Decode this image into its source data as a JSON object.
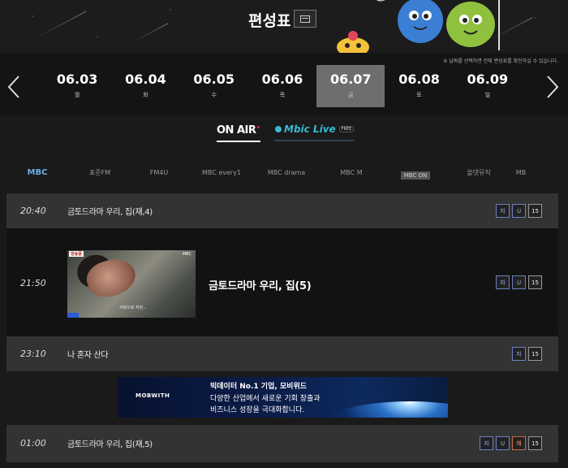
{
  "header": {
    "title": "편성표",
    "tv_button_icon": "tv-icon"
  },
  "datebar": {
    "notice": "※ 날짜를 선택하면 전체 편성표를 확인하실 수 있습니다.",
    "dates": [
      {
        "date": "06.03",
        "weekday": "월",
        "active": false
      },
      {
        "date": "06.04",
        "weekday": "화",
        "active": false
      },
      {
        "date": "06.05",
        "weekday": "수",
        "active": false
      },
      {
        "date": "06.06",
        "weekday": "목",
        "active": false
      },
      {
        "date": "06.07",
        "weekday": "금",
        "active": true
      },
      {
        "date": "06.08",
        "weekday": "토",
        "active": false
      },
      {
        "date": "06.09",
        "weekday": "일",
        "active": false
      }
    ]
  },
  "modes": {
    "onair": "ON AIR",
    "onair_dot": "•",
    "mbic": "Mbic Live",
    "mbic_badge": "FREE"
  },
  "channels": [
    {
      "label": "MBC",
      "active": true
    },
    {
      "label": "표준FM",
      "active": false
    },
    {
      "label": "FM4U",
      "active": false
    },
    {
      "label": "MBC every1",
      "active": false
    },
    {
      "label": "MBC drama",
      "active": false
    },
    {
      "label": "MBC M",
      "active": false
    },
    {
      "label": "MBC ON",
      "active": false
    },
    {
      "label": "올댓뮤직",
      "active": false
    },
    {
      "label": "MB",
      "active": false
    }
  ],
  "schedule": [
    {
      "time": "20:40",
      "title": "금토드라마 우리, 집(재,4)",
      "badges": [
        "자",
        "U",
        "15"
      ]
    },
    {
      "time": "21:50",
      "title": "금토드라마 우리, 집(5)",
      "badges": [
        "자",
        "U",
        "15"
      ]
    },
    {
      "time": "23:10",
      "title": "나 혼자 산다",
      "badges": [
        "자",
        "15"
      ]
    },
    {
      "time": "01:00",
      "title": "금토드라마 우리, 집(재,5)",
      "badges": [
        "자",
        "U",
        "해",
        "15"
      ]
    }
  ],
  "thumb": {
    "tag": "방송중",
    "channel": "MBC",
    "subtitle": "사랑으로 자란..."
  },
  "ad": {
    "brand": "MOBWITH",
    "line1": "빅데이터 No.1 기업, 모비위드",
    "line2": "다양한 산업에서 새로운 기회 창출과",
    "line3": "비즈니스 성장을 극대화합니다."
  },
  "colors": {
    "active_date_bg": "#6e6e6e",
    "row_bg": "#333333",
    "accent_blue": "#6fb0e8",
    "onair_dot": "#e0263b"
  }
}
